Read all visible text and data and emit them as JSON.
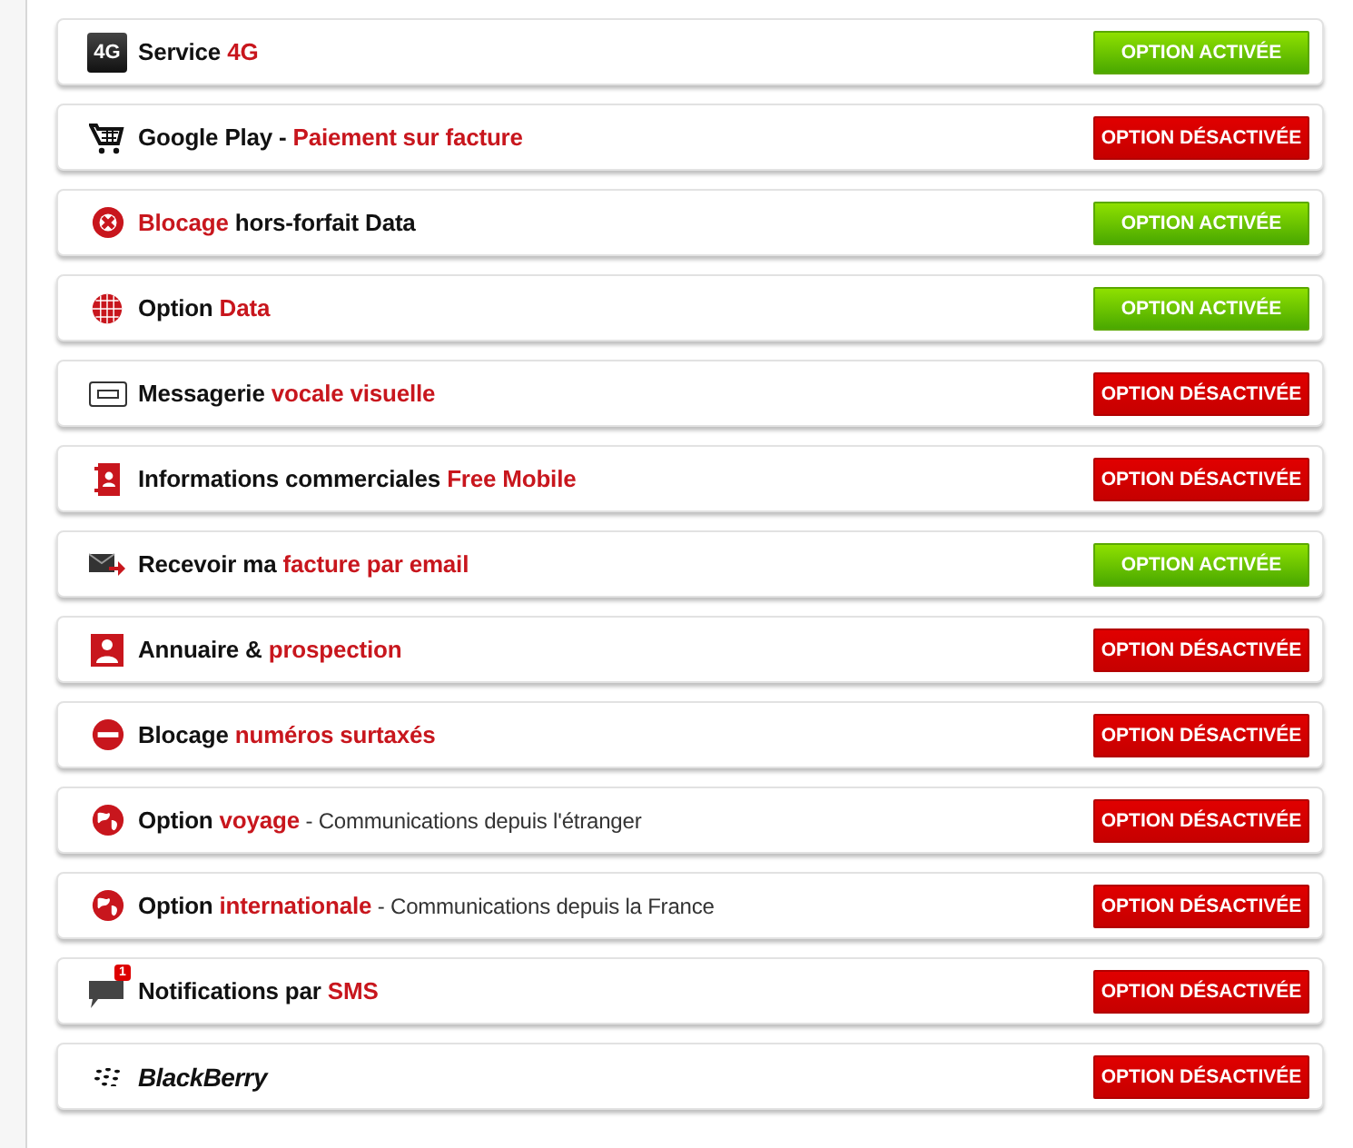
{
  "options": [
    {
      "badge": "4G",
      "label": [
        {
          "text": "Service ",
          "kind": "plain"
        },
        {
          "text": "4G",
          "kind": "highlight"
        }
      ],
      "active": true,
      "button": "OPTION ACTIVÉE"
    },
    {
      "label": [
        {
          "text": "Google Play - ",
          "kind": "plain"
        },
        {
          "text": "Paiement sur facture",
          "kind": "highlight"
        }
      ],
      "active": false,
      "button": "OPTION DÉSACTIVÉE"
    },
    {
      "label": [
        {
          "text": "Blocage",
          "kind": "highlight"
        },
        {
          "text": " hors-forfait Data",
          "kind": "plain"
        }
      ],
      "active": true,
      "button": "OPTION ACTIVÉE"
    },
    {
      "label": [
        {
          "text": "Option ",
          "kind": "plain"
        },
        {
          "text": "Data",
          "kind": "highlight"
        }
      ],
      "active": true,
      "button": "OPTION ACTIVÉE"
    },
    {
      "label": [
        {
          "text": "Messagerie ",
          "kind": "plain"
        },
        {
          "text": "vocale visuelle",
          "kind": "highlight"
        }
      ],
      "active": false,
      "button": "OPTION DÉSACTIVÉE"
    },
    {
      "label": [
        {
          "text": "Informations commerciales ",
          "kind": "plain"
        },
        {
          "text": "Free Mobile",
          "kind": "highlight"
        }
      ],
      "active": false,
      "button": "OPTION DÉSACTIVÉE"
    },
    {
      "label": [
        {
          "text": "Recevoir ma ",
          "kind": "plain"
        },
        {
          "text": "facture par email",
          "kind": "highlight"
        }
      ],
      "active": true,
      "button": "OPTION ACTIVÉE"
    },
    {
      "label": [
        {
          "text": "Annuaire & ",
          "kind": "plain"
        },
        {
          "text": "prospection",
          "kind": "highlight"
        }
      ],
      "active": false,
      "button": "OPTION DÉSACTIVÉE"
    },
    {
      "label": [
        {
          "text": "Blocage ",
          "kind": "plain"
        },
        {
          "text": "numéros surtaxés",
          "kind": "highlight"
        }
      ],
      "active": false,
      "button": "OPTION DÉSACTIVÉE"
    },
    {
      "label": [
        {
          "text": "Option ",
          "kind": "plain"
        },
        {
          "text": "voyage",
          "kind": "highlight"
        },
        {
          "text": " - Communications depuis l'étranger",
          "kind": "note"
        }
      ],
      "active": false,
      "button": "OPTION DÉSACTIVÉE"
    },
    {
      "label": [
        {
          "text": "Option ",
          "kind": "plain"
        },
        {
          "text": "internationale",
          "kind": "highlight"
        },
        {
          "text": " - Communications depuis la France",
          "kind": "note"
        }
      ],
      "active": false,
      "button": "OPTION DÉSACTIVÉE"
    },
    {
      "badge": "1",
      "label": [
        {
          "text": "Notifications par ",
          "kind": "plain"
        },
        {
          "text": "SMS",
          "kind": "highlight"
        }
      ],
      "active": false,
      "button": "OPTION DÉSACTIVÉE"
    },
    {
      "label": [
        {
          "text": "BlackBerry",
          "kind": "logo"
        }
      ],
      "active": false,
      "button": "OPTION DÉSACTIVÉE"
    }
  ]
}
